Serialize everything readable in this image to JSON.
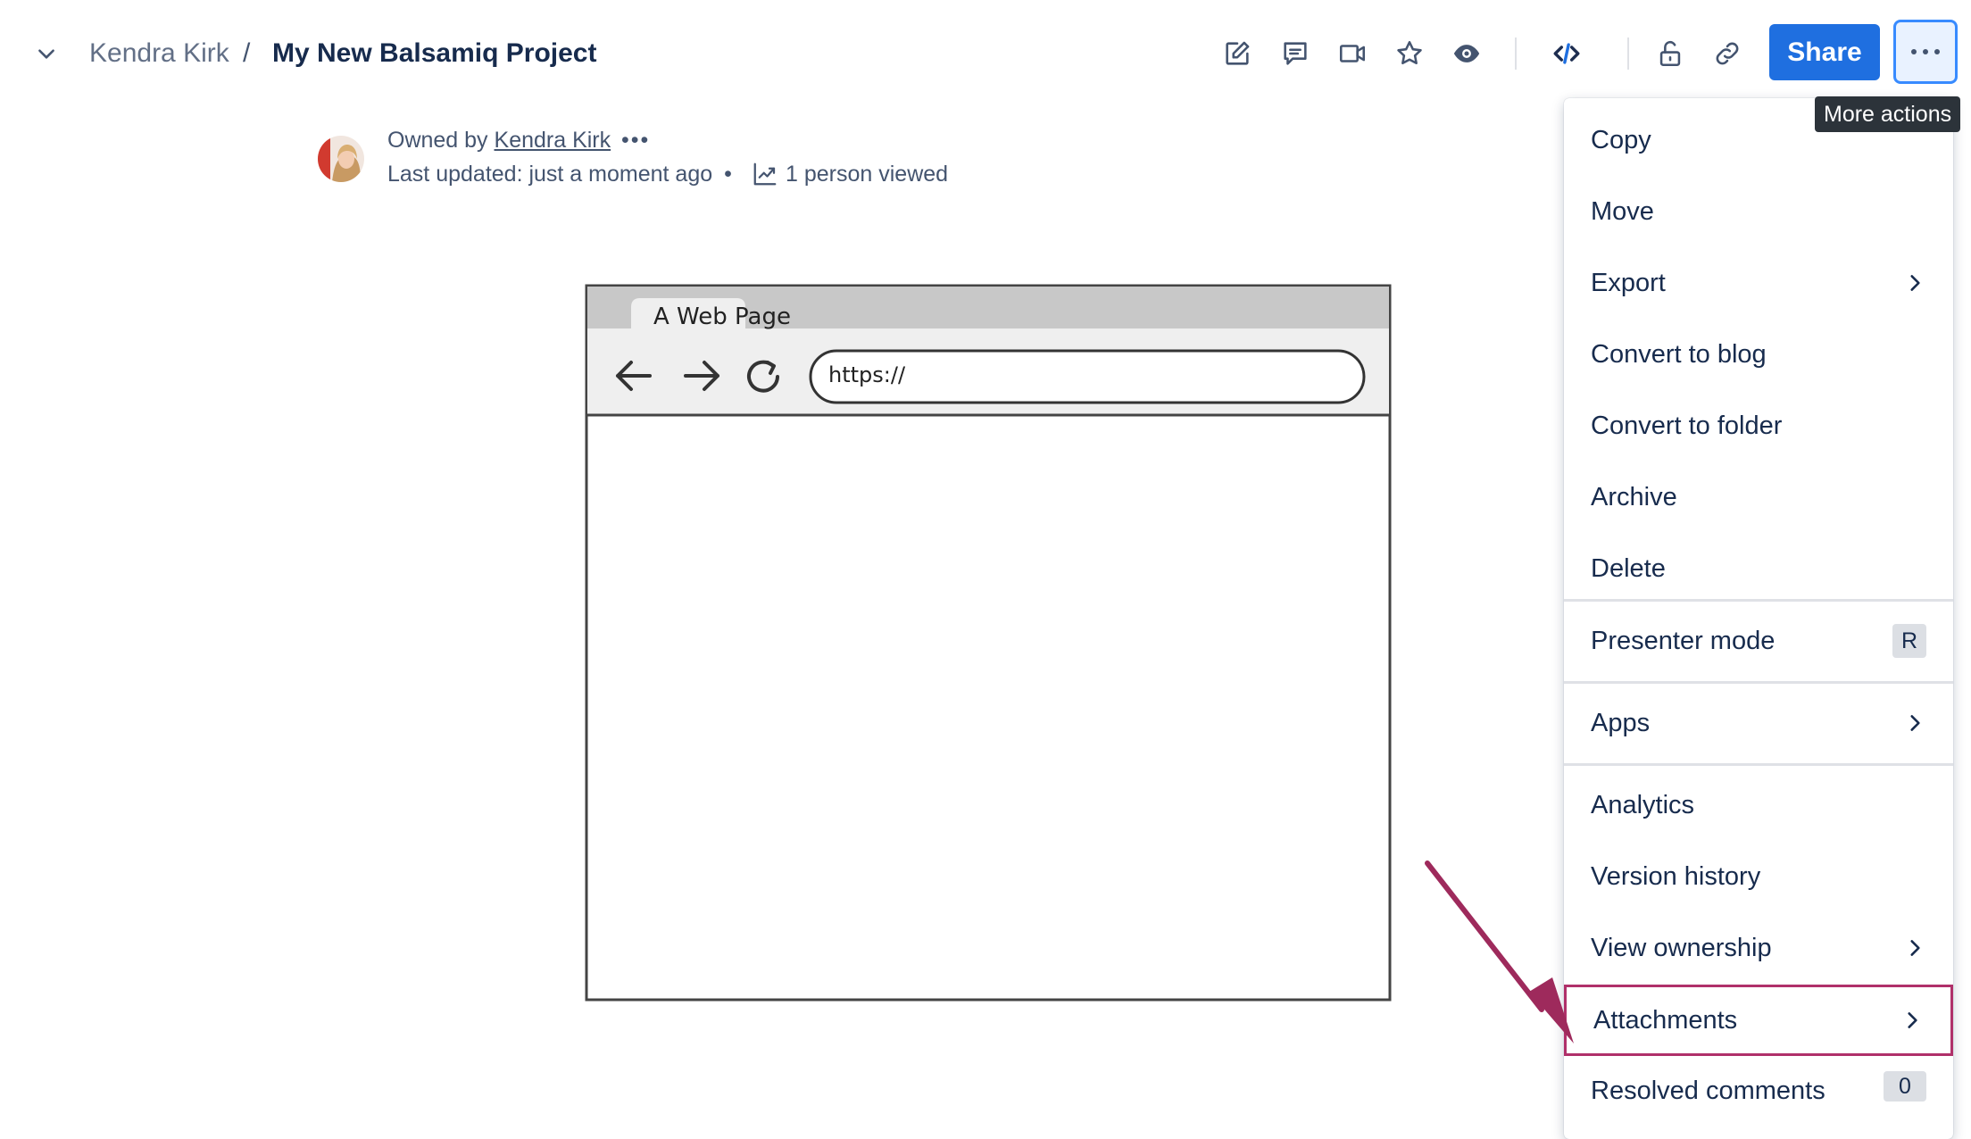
{
  "breadcrumb": {
    "owner": "Kendra Kirk",
    "separator": "/",
    "title": "My New Balsamiq Project"
  },
  "toolbar": {
    "icons": [
      "edit-icon",
      "comment-icon",
      "video-icon",
      "star-icon",
      "eye-icon",
      "embed-icon",
      "unlock-icon",
      "link-icon"
    ],
    "share_label": "Share",
    "more_tooltip": "More actions"
  },
  "byline": {
    "owned_prefix": "Owned by",
    "owner_name": "Kendra Kirk",
    "more": "•••",
    "last_updated": "Last updated: just a moment ago",
    "dot": "•",
    "viewed": "1 person viewed"
  },
  "wireframe": {
    "tab_label": "A Web Page",
    "url": "https://"
  },
  "menu": {
    "items": [
      {
        "label": "Copy"
      },
      {
        "label": "Move"
      },
      {
        "label": "Export"
      },
      {
        "label": "Convert to blog"
      },
      {
        "label": "Convert to folder"
      },
      {
        "label": "Archive"
      },
      {
        "label": "Delete"
      },
      {
        "label": "Presenter mode",
        "shortcut": "R"
      },
      {
        "label": "Apps"
      },
      {
        "label": "Analytics"
      },
      {
        "label": "Version history"
      },
      {
        "label": "View ownership"
      },
      {
        "label": "Attachments"
      },
      {
        "label": "Resolved comments",
        "badge": "0"
      }
    ]
  },
  "colors": {
    "accent": "#1f6fe0",
    "highlight": "#b0306a",
    "arrow": "#9e2a5c"
  }
}
